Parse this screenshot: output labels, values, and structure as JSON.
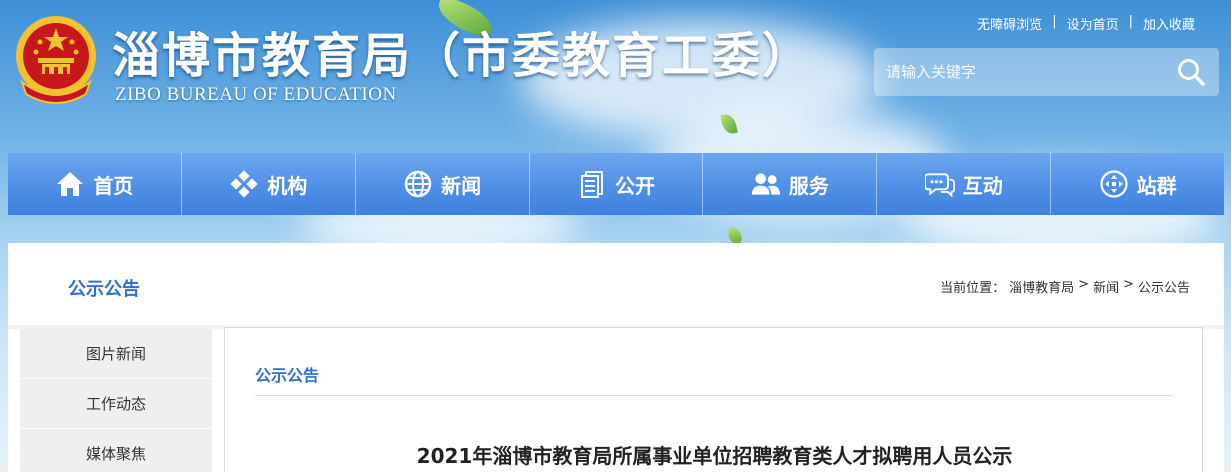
{
  "header": {
    "title": "淄博市教育局（市委教育工委）",
    "subtitle": "ZIBO BUREAU OF EDUCATION",
    "emblem_icon": "national-emblem-icon"
  },
  "toplinks": [
    {
      "label": "无障碍浏览"
    },
    {
      "label": "设为首页"
    },
    {
      "label": "加入收藏"
    }
  ],
  "search": {
    "placeholder": "请输入关键字",
    "icon": "search-icon"
  },
  "nav": [
    {
      "label": "首页",
      "icon": "home-icon"
    },
    {
      "label": "机构",
      "icon": "org-icon"
    },
    {
      "label": "新闻",
      "icon": "globe-icon"
    },
    {
      "label": "公开",
      "icon": "document-icon"
    },
    {
      "label": "服务",
      "icon": "users-icon"
    },
    {
      "label": "互动",
      "icon": "chat-icon"
    },
    {
      "label": "站群",
      "icon": "sitemap-icon"
    }
  ],
  "section": {
    "title": "公示公告"
  },
  "breadcrumb": {
    "prefix": "当前位置：",
    "items": [
      "淄博教育局",
      "新闻",
      "公示公告"
    ],
    "separator": ">"
  },
  "sidebar": {
    "items": [
      "图片新闻",
      "工作动态",
      "媒体聚焦"
    ]
  },
  "main": {
    "title": "公示公告",
    "article_title": "2021年淄博市教育局所属事业单位招聘教育类人才拟聘用人员公示"
  },
  "colors": {
    "accent": "#2f6fd0",
    "nav_top": "#6ea6ee",
    "nav_bottom": "#3f80dc",
    "emblem_red": "#c8161d",
    "emblem_gold": "#f2c230"
  }
}
